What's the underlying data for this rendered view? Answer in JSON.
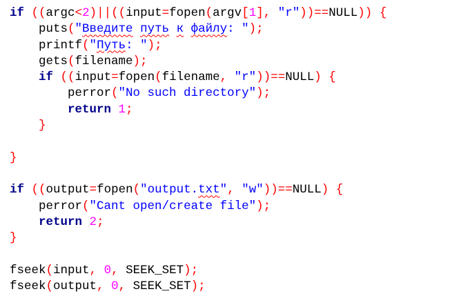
{
  "editor": {
    "language": "C",
    "colors": {
      "keyword": "#00008b",
      "operator": "#ff0000",
      "number": "#ff00ff",
      "string": "#0000ff",
      "identifier": "#000000",
      "spellcheck_underline": "#ff0000"
    },
    "lines": [
      [
        [
          "kw",
          "if"
        ],
        [
          "ident",
          " "
        ],
        [
          "op",
          "(("
        ],
        [
          "ident",
          "argc"
        ],
        [
          "op",
          "<"
        ],
        [
          "num",
          "2"
        ],
        [
          "op",
          ")||(("
        ],
        [
          "ident",
          "input"
        ],
        [
          "op",
          "="
        ],
        [
          "ident",
          "fopen"
        ],
        [
          "op",
          "("
        ],
        [
          "ident",
          "argv"
        ],
        [
          "op",
          "["
        ],
        [
          "num",
          "1"
        ],
        [
          "op",
          "],"
        ],
        [
          "ident",
          " "
        ],
        [
          "str",
          "\"r\""
        ],
        [
          "op",
          "))=="
        ],
        [
          "ident",
          "NULL"
        ],
        [
          "op",
          "))"
        ],
        [
          "ident",
          " "
        ],
        [
          "brace",
          "{"
        ]
      ],
      [
        [
          "ident",
          "    puts"
        ],
        [
          "op",
          "("
        ],
        [
          "str",
          "\""
        ],
        [
          "str_spell",
          "Введите"
        ],
        [
          "str",
          " "
        ],
        [
          "str_spell",
          "путь"
        ],
        [
          "str",
          " "
        ],
        [
          "str_spell",
          "к"
        ],
        [
          "str",
          " "
        ],
        [
          "str_spell",
          "файлу"
        ],
        [
          "str",
          ": \""
        ],
        [
          "op",
          ");"
        ]
      ],
      [
        [
          "ident",
          "    printf"
        ],
        [
          "op",
          "("
        ],
        [
          "str",
          "\""
        ],
        [
          "str_spell",
          "Путь"
        ],
        [
          "str",
          ": \""
        ],
        [
          "op",
          ");"
        ]
      ],
      [
        [
          "ident",
          "    gets"
        ],
        [
          "op",
          "("
        ],
        [
          "ident",
          "filename"
        ],
        [
          "op",
          ");"
        ]
      ],
      [
        [
          "ident",
          "    "
        ],
        [
          "kw",
          "if"
        ],
        [
          "ident",
          " "
        ],
        [
          "op",
          "(("
        ],
        [
          "ident",
          "input"
        ],
        [
          "op",
          "="
        ],
        [
          "ident",
          "fopen"
        ],
        [
          "op",
          "("
        ],
        [
          "ident",
          "filename"
        ],
        [
          "op",
          ","
        ],
        [
          "ident",
          " "
        ],
        [
          "str",
          "\"r\""
        ],
        [
          "op",
          "))=="
        ],
        [
          "ident",
          "NULL"
        ],
        [
          "op",
          ")"
        ],
        [
          "ident",
          " "
        ],
        [
          "brace",
          "{"
        ]
      ],
      [
        [
          "ident",
          "        perror"
        ],
        [
          "op",
          "("
        ],
        [
          "str",
          "\"No such directory\""
        ],
        [
          "op",
          ");"
        ]
      ],
      [
        [
          "ident",
          "        "
        ],
        [
          "kw",
          "return"
        ],
        [
          "ident",
          " "
        ],
        [
          "num",
          "1"
        ],
        [
          "op",
          ";"
        ]
      ],
      [
        [
          "ident",
          "    "
        ],
        [
          "brace",
          "}"
        ]
      ],
      [],
      [
        [
          "brace",
          "}"
        ]
      ],
      [],
      [
        [
          "kw",
          "if"
        ],
        [
          "ident",
          " "
        ],
        [
          "op",
          "(("
        ],
        [
          "ident",
          "output"
        ],
        [
          "op",
          "="
        ],
        [
          "ident",
          "fopen"
        ],
        [
          "op",
          "("
        ],
        [
          "str",
          "\"output."
        ],
        [
          "str_spell",
          "txt"
        ],
        [
          "str",
          "\""
        ],
        [
          "op",
          ","
        ],
        [
          "ident",
          " "
        ],
        [
          "str",
          "\"w\""
        ],
        [
          "op",
          "))=="
        ],
        [
          "ident",
          "NULL"
        ],
        [
          "op",
          ")"
        ],
        [
          "ident",
          " "
        ],
        [
          "brace",
          "{"
        ]
      ],
      [
        [
          "ident",
          "    perror"
        ],
        [
          "op",
          "("
        ],
        [
          "str",
          "\"Cant open/create file\""
        ],
        [
          "op",
          ");"
        ]
      ],
      [
        [
          "ident",
          "    "
        ],
        [
          "kw",
          "return"
        ],
        [
          "ident",
          " "
        ],
        [
          "num",
          "2"
        ],
        [
          "op",
          ";"
        ]
      ],
      [
        [
          "brace",
          "}"
        ]
      ],
      [],
      [
        [
          "ident",
          "fseek"
        ],
        [
          "op",
          "("
        ],
        [
          "ident",
          "input"
        ],
        [
          "op",
          ","
        ],
        [
          "ident",
          " "
        ],
        [
          "num",
          "0"
        ],
        [
          "op",
          ","
        ],
        [
          "ident",
          " SEEK_SET"
        ],
        [
          "op",
          ");"
        ]
      ],
      [
        [
          "ident",
          "fseek"
        ],
        [
          "op",
          "("
        ],
        [
          "ident",
          "output"
        ],
        [
          "op",
          ","
        ],
        [
          "ident",
          " "
        ],
        [
          "num",
          "0"
        ],
        [
          "op",
          ","
        ],
        [
          "ident",
          " SEEK_SET"
        ],
        [
          "op",
          ");"
        ]
      ]
    ]
  }
}
